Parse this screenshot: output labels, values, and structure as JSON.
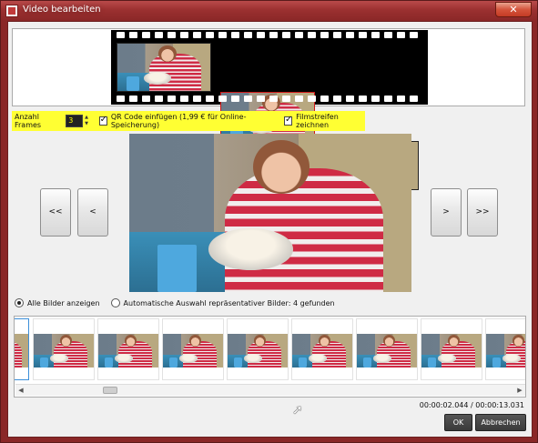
{
  "window": {
    "title": "Video bearbeiten",
    "close_label": "✕"
  },
  "options": {
    "frames_label": "Anzahl Frames",
    "frames_value": "3",
    "qr_label": "QR Code einfügen (1,99 € für Online-Speicherung)",
    "qr_checked": true,
    "film_label": "Filmstreifen zeichnen",
    "film_checked": true
  },
  "nav": {
    "first": "<<",
    "prev": "<",
    "next": ">",
    "last": ">>"
  },
  "radios": {
    "all_label": "Alle Bilder anzeigen",
    "auto_label": "Automatische Auswahl repräsentativer Bilder: 4 gefunden",
    "selected": "all"
  },
  "time": {
    "display": "00:00:02.044 / 00:00:13.031"
  },
  "buttons": {
    "ok": "OK",
    "cancel": "Abbrechen"
  },
  "colors": {
    "highlight": "#ffff33",
    "selected_frame": "#d01818",
    "active_thumb": "#3c8fd9"
  }
}
